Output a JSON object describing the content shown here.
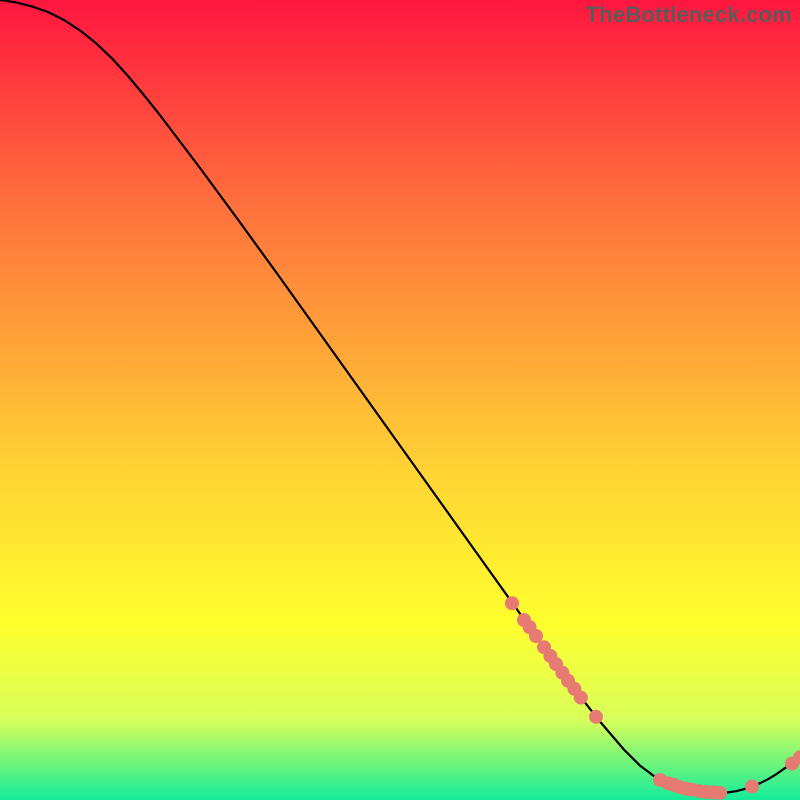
{
  "watermark": "TheBottleneck.com",
  "chart_data": {
    "type": "line",
    "title": "",
    "xlabel": "",
    "ylabel": "",
    "xlim": [
      0,
      100
    ],
    "ylim": [
      0,
      100
    ],
    "grid": false,
    "legend": false,
    "background": {
      "gradient_top": "#ff163f",
      "gradient_mid2": "#ff6e3d",
      "gradient_mid3": "#ffd134",
      "gradient_mid4": "#ffff2e",
      "gradient_mid5": "#d8ff5a",
      "gradient_bottom": "#13ec9a"
    },
    "series": [
      {
        "name": "curve",
        "color": "#000000",
        "x": [
          0,
          2,
          4,
          6,
          8,
          10,
          12,
          14,
          16,
          18,
          20,
          25,
          30,
          35,
          40,
          45,
          50,
          55,
          60,
          65,
          68,
          70,
          72,
          75,
          78,
          80,
          82,
          84,
          86,
          88,
          90,
          91,
          92,
          93,
          94,
          95,
          96,
          97,
          98,
          99,
          100
        ],
        "y": [
          100,
          99.7,
          99.2,
          98.5,
          97.5,
          96.2,
          94.6,
          92.7,
          90.5,
          88.1,
          85.6,
          79.0,
          72.2,
          65.3,
          58.3,
          51.3,
          44.3,
          37.3,
          30.3,
          23.3,
          19.1,
          16.3,
          13.6,
          9.8,
          6.3,
          4.3,
          2.8,
          1.8,
          1.2,
          0.9,
          0.9,
          0.95,
          1.1,
          1.35,
          1.7,
          2.1,
          2.6,
          3.2,
          3.9,
          4.6,
          5.3
        ]
      }
    ],
    "markers": [
      {
        "name": "cluster-steep",
        "color": "#e77b73",
        "x": [
          64.0,
          65.5,
          66.2,
          67.0,
          68.0,
          68.8,
          69.5,
          70.3,
          71.0,
          71.8,
          72.6,
          74.5
        ],
        "y": [
          24.6,
          22.5,
          21.6,
          20.5,
          19.1,
          18.0,
          17.0,
          15.9,
          14.9,
          13.9,
          12.8,
          10.4
        ]
      },
      {
        "name": "cluster-valley",
        "color": "#e77b73",
        "x": [
          82.5,
          83.5,
          84.2,
          85.0,
          85.8,
          86.5,
          87.5,
          88.3,
          89.2,
          90.0,
          94.0
        ],
        "y": [
          2.5,
          2.1,
          1.9,
          1.6,
          1.4,
          1.3,
          1.1,
          1.0,
          0.95,
          0.9,
          1.7
        ]
      },
      {
        "name": "endpoint-markers",
        "color": "#e77b73",
        "x": [
          99.0,
          100.0
        ],
        "y": [
          4.55,
          5.35
        ]
      }
    ]
  }
}
